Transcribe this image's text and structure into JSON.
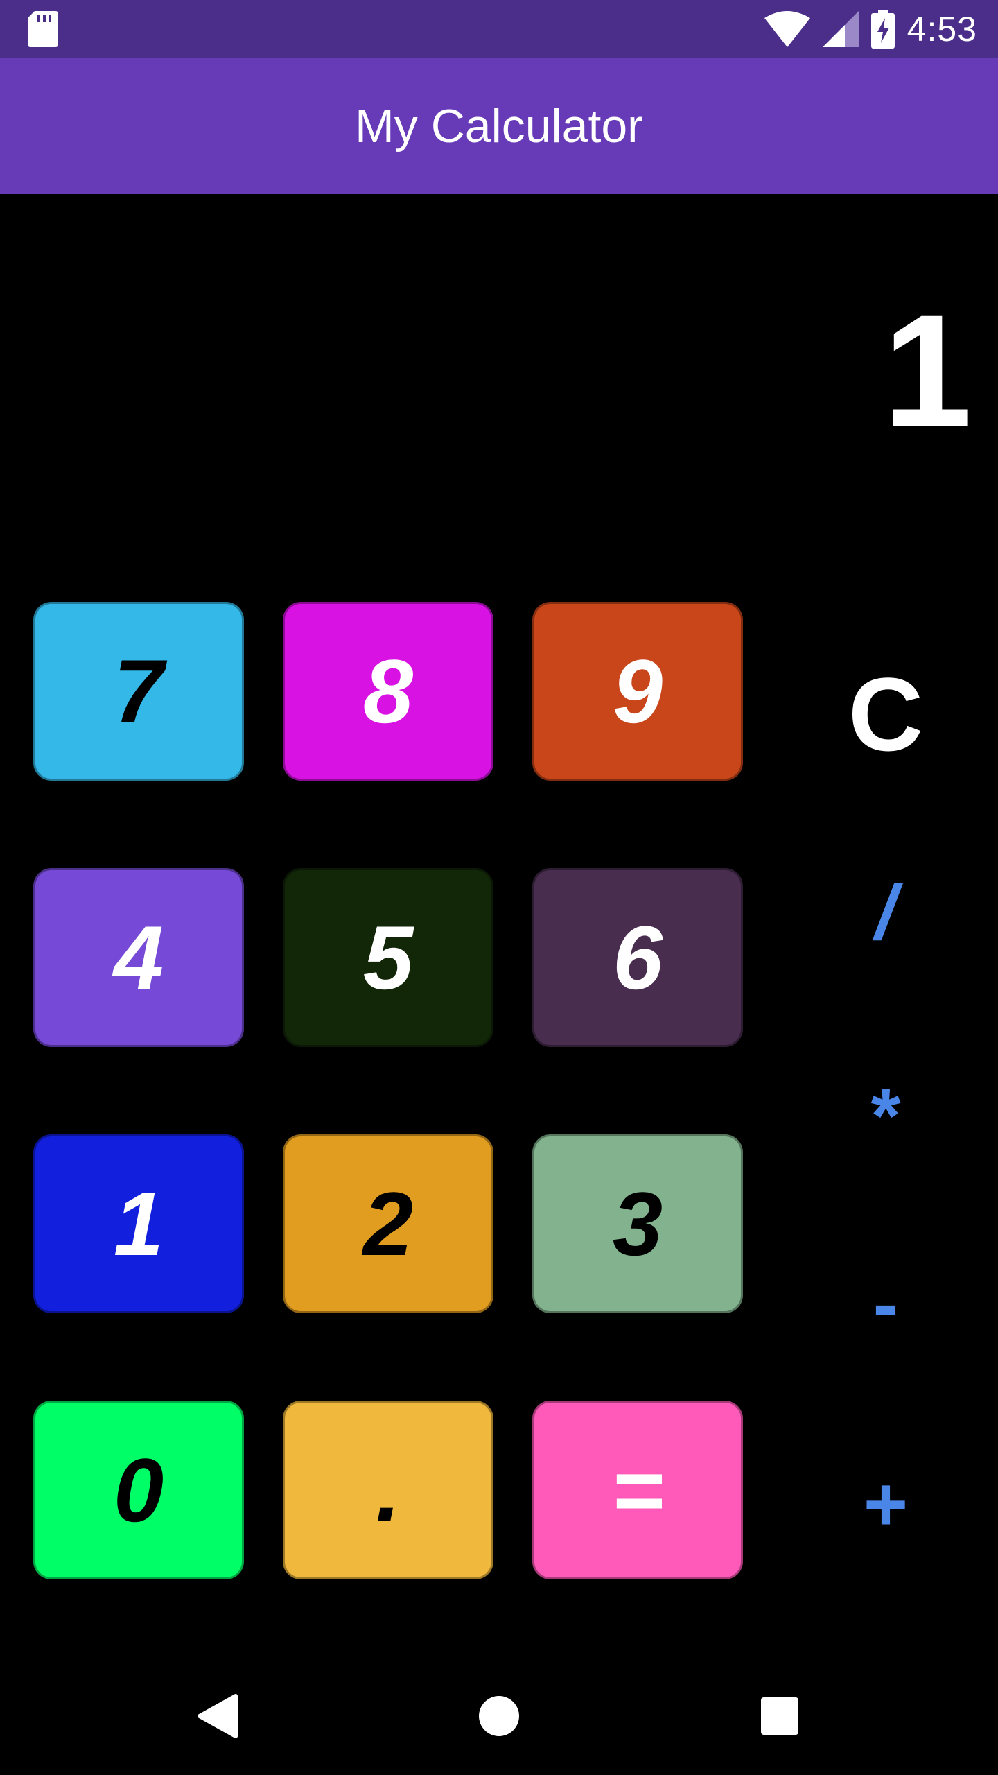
{
  "status_bar": {
    "time": "4:53",
    "icons": [
      "sd-card-icon",
      "wifi-icon",
      "signal-icon",
      "battery-charging-icon"
    ]
  },
  "app_bar": {
    "title": "My Calculator"
  },
  "display": {
    "value": "1"
  },
  "keys": {
    "k7": {
      "label": "7",
      "bg": "#33b8e8",
      "fg": "#000000"
    },
    "k8": {
      "label": "8",
      "bg": "#d812e3",
      "fg": "#ffffff"
    },
    "k9": {
      "label": "9",
      "bg": "#c8461a",
      "fg": "#ffffff"
    },
    "k4": {
      "label": "4",
      "bg": "#7649d6",
      "fg": "#ffffff"
    },
    "k5": {
      "label": "5",
      "bg": "#122608",
      "fg": "#ffffff"
    },
    "k6": {
      "label": "6",
      "bg": "#482d4e",
      "fg": "#ffffff"
    },
    "k1": {
      "label": "1",
      "bg": "#1220dd",
      "fg": "#ffffff"
    },
    "k2": {
      "label": "2",
      "bg": "#e09d1f",
      "fg": "#000000"
    },
    "k3": {
      "label": "3",
      "bg": "#82b28e",
      "fg": "#000000"
    },
    "k0": {
      "label": "0",
      "bg": "#00ff66",
      "fg": "#000000"
    },
    "kdot": {
      "label": ".",
      "bg": "#f0b83d",
      "fg": "#000000"
    },
    "keq": {
      "label": "=",
      "bg": "#ff5ab9",
      "fg": "#ffffff"
    }
  },
  "operators": {
    "clear": {
      "label": "C",
      "color": "#ffffff"
    },
    "divide": {
      "label": "/",
      "color": "#4a86e8"
    },
    "multiply": {
      "label": "*",
      "color": "#4a86e8"
    },
    "subtract": {
      "label": "-",
      "color": "#4a86e8"
    },
    "add": {
      "label": "+",
      "color": "#4a86e8"
    }
  },
  "nav_bar": {
    "icons": [
      "back-icon",
      "home-icon",
      "recents-icon"
    ]
  }
}
